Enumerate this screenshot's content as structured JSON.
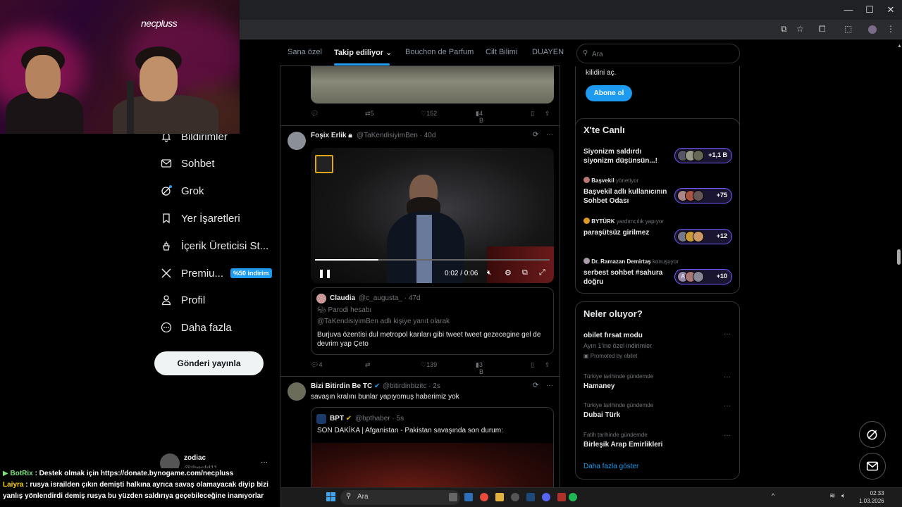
{
  "browser": {
    "window_controls": [
      "—",
      "☐",
      "✕"
    ]
  },
  "webcam": {
    "logo": "necpluss"
  },
  "nav": {
    "items": [
      {
        "label": "Bildirimler",
        "icon": "bell-icon"
      },
      {
        "label": "Sohbet",
        "icon": "mail-icon"
      },
      {
        "label": "Grok",
        "icon": "grok-icon"
      },
      {
        "label": "Yer İşaretleri",
        "icon": "bookmark-icon"
      },
      {
        "label": "İçerik Üreticisi St...",
        "icon": "creator-studio-icon"
      },
      {
        "label": "Premiu...",
        "icon": "x-logo-icon"
      },
      {
        "label": "Profil",
        "icon": "person-icon"
      },
      {
        "label": "Daha fazla",
        "icon": "more-circle-icon"
      }
    ],
    "premium_badge": "%50 indirim",
    "post_button": "Gönderi yayınla",
    "account": {
      "name": "zodiac",
      "handle": "@thesfd11",
      "more": "···"
    }
  },
  "tabs": [
    "Sana özel",
    "Takip ediliyor",
    "Bouchon de Parfum",
    "Cilt Bilimi",
    "DUAYEN"
  ],
  "feed": {
    "post0_actions": {
      "reply": "",
      "repost": "5",
      "like": "152",
      "views": "4 B"
    },
    "post1": {
      "name": "Foşix Erlik",
      "handle": "@TaKendisiyimBen",
      "time": "40d",
      "video_time": "0:02 / 0:06",
      "progress": 0.27,
      "quote": {
        "name": "Claudia",
        "handle": "@c_augusta_",
        "time": "47d",
        "parody": "Parodi hesabı",
        "reply_to": "@TaKendisiyimBen adlı kişiye yanıt olarak",
        "text_line1": "Burjuva özentisi dul metropol karıları gibi tweet tweet gezecegine gel de",
        "text_line2": "devrim yap Çeto"
      },
      "actions": {
        "reply": "4",
        "repost": "",
        "like": "139",
        "views": "3 B"
      }
    },
    "post2": {
      "name": "Bizi Bitirdin Be TC",
      "handle": "@bitirdinbizitc",
      "time": "2s",
      "text": "savaşın kralını bunlar yapıyomuş haberimiz yok",
      "quote": {
        "name": "BPT",
        "handle": "@bpthaber",
        "time": "5s",
        "text": "SON DAKİKA | Afganistan - Pakistan savaşında son durum:"
      }
    }
  },
  "sidebar": {
    "search_placeholder": "Ara",
    "subscribe": {
      "text": "kilidini aç.",
      "button": "Abone ol"
    },
    "live": {
      "title": "X'te Canlı",
      "items": [
        {
          "host": "",
          "role": "",
          "title1": "Siyonizm saldırdı",
          "title2": "siyonizm düşünsün...!",
          "count": "+1,1 B"
        },
        {
          "host": "Başvekil",
          "role": "yönetiyor",
          "title1": "Başvekil adlı kullanıcının",
          "title2": "Sohbet Odası",
          "count": "+75"
        },
        {
          "host": "BYTÜRK",
          "role": "yardımcılık yapıyor",
          "title1": "paraşütsüz girilmez",
          "title2": "",
          "count": "+12"
        },
        {
          "host": "Dr. Ramazan Demirtaş",
          "role": "konuşuyor",
          "title1": "serbest sohbet #sahura",
          "title2": "doğru",
          "count": "+10"
        }
      ]
    },
    "trends": {
      "title": "Neler oluyor?",
      "items": [
        {
          "category": "",
          "name": "obilet fırsat modu",
          "sub": "Ayın 1'ine özel indirimler",
          "promo": "Promoted by obilet"
        },
        {
          "category": "Türkiye tarihinde gündemde",
          "name": "Hamaney"
        },
        {
          "category": "Türkiye tarihinde gündemde",
          "name": "Dubai Türk"
        },
        {
          "category": "Fatih tarihinde gündemde",
          "name": "Birleşik Arap Emirlikleri"
        }
      ],
      "more": "Daha fazla göster"
    }
  },
  "chat": [
    {
      "user": "BotRix",
      "color": "#7be37b",
      "message": "Destek olmak için https://donate.bynogame.com/necpluss"
    },
    {
      "user": "Laiyra",
      "color": "#ffd400",
      "message": "rusya israilden çıkın demişti halkına ayrıca savaş olamayacak diyip bizi"
    },
    {
      "user": "",
      "color": "#ffffff",
      "message": "yanlış yönlendirdi demiş rusya bu yüzden saldırıya geçebileceğine inanıyorlar"
    }
  ],
  "taskbar": {
    "search": "Ara",
    "time": "02:33",
    "date": "1.03.2026"
  }
}
